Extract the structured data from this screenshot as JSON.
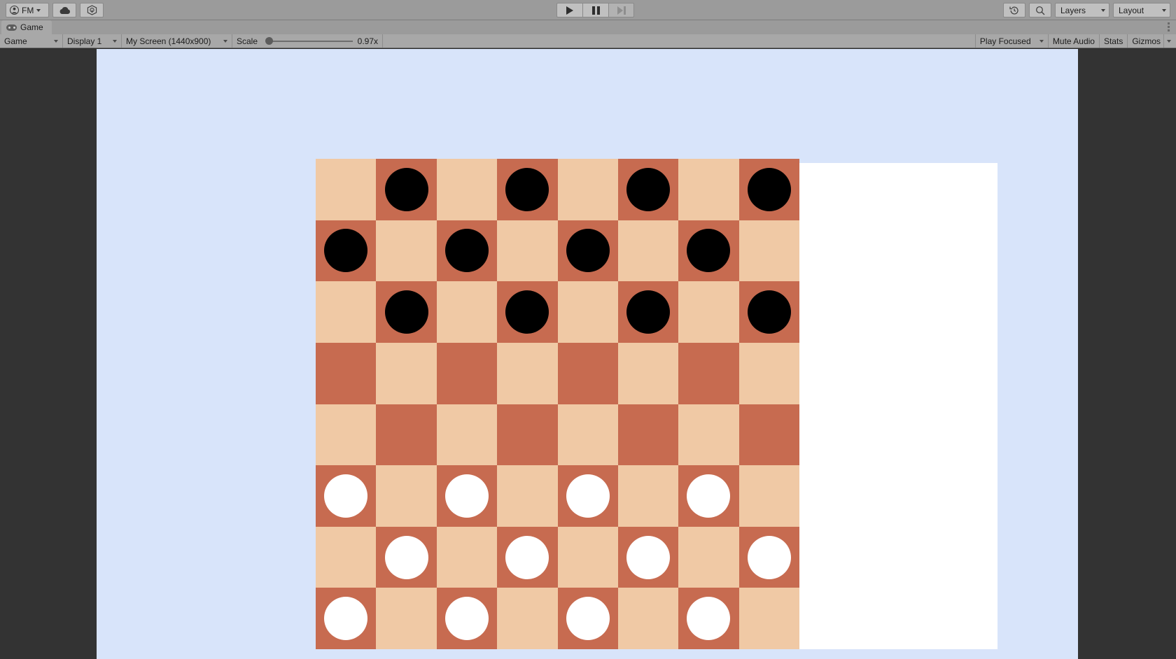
{
  "top_toolbar": {
    "account": {
      "label": "FM",
      "icon": "account-icon"
    },
    "cloud": {
      "icon": "cloud-icon"
    },
    "package_manager": {
      "icon": "package-manager-icon"
    },
    "play_controls": {
      "play": {
        "label": "",
        "icon": "play-icon",
        "state": "off"
      },
      "pause": {
        "label": "",
        "icon": "pause-icon",
        "state": "off"
      },
      "step": {
        "label": "",
        "icon": "step-icon",
        "state": "disabled"
      }
    },
    "undo_history": {
      "icon": "undo-history-icon"
    },
    "search": {
      "icon": "search-icon"
    },
    "layers": {
      "label": "Layers",
      "icon": "chevron-down-icon"
    },
    "layout": {
      "label": "Layout",
      "icon": "chevron-down-icon"
    }
  },
  "tabstrip": {
    "tabs": [
      {
        "label": "Game",
        "icon": "gamepad-icon",
        "active": true
      }
    ],
    "overflow_menu": {
      "icon": "kebab-menu-icon"
    }
  },
  "game_toolbar": {
    "view_mode": {
      "label": "Game",
      "icon": "chevron-down-icon"
    },
    "display": {
      "label": "Display 1",
      "icon": "chevron-down-icon"
    },
    "resolution": {
      "label": "My Screen (1440x900)",
      "icon": "chevron-down-icon"
    },
    "scale": {
      "label": "Scale",
      "value": "0.97x",
      "slider_pct": 3
    },
    "play_mode": {
      "label": "Play Focused",
      "icon": "chevron-down-icon"
    },
    "mute_audio": {
      "label": "Mute Audio"
    },
    "stats": {
      "label": "Stats"
    },
    "gizmos": {
      "label": "Gizmos",
      "icon": "chevron-down-icon"
    }
  },
  "game_view": {
    "background_color": "#d8e4fa",
    "editor_background_color": "#333333",
    "side_panel": {
      "color": "#ffffff",
      "name": "ui-canvas-panel"
    },
    "board": {
      "rows": 8,
      "cols": 8,
      "light_square_color": "#f0c9a5",
      "dark_square_color": "#c76b50",
      "black_piece_color": "#000000",
      "white_piece_color": "#ffffff",
      "layout": [
        [
          "",
          "b",
          "",
          "b",
          "",
          "b",
          "",
          "b"
        ],
        [
          "b",
          "",
          "b",
          "",
          "b",
          "",
          "b",
          ""
        ],
        [
          "",
          "b",
          "",
          "b",
          "",
          "b",
          "",
          "b"
        ],
        [
          "",
          "",
          "",
          "",
          "",
          "",
          "",
          ""
        ],
        [
          "",
          "",
          "",
          "",
          "",
          "",
          "",
          ""
        ],
        [
          "w",
          "",
          "w",
          "",
          "w",
          "",
          "w",
          ""
        ],
        [
          "",
          "w",
          "",
          "w",
          "",
          "w",
          "",
          "w"
        ],
        [
          "w",
          "",
          "w",
          "",
          "w",
          "",
          "w",
          ""
        ]
      ],
      "square_colors": [
        [
          "light",
          "dark",
          "light",
          "dark",
          "light",
          "dark",
          "light",
          "dark"
        ],
        [
          "dark",
          "light",
          "dark",
          "light",
          "dark",
          "light",
          "dark",
          "light"
        ],
        [
          "light",
          "dark",
          "light",
          "dark",
          "light",
          "dark",
          "light",
          "dark"
        ],
        [
          "dark",
          "light",
          "dark",
          "light",
          "dark",
          "light",
          "dark",
          "light"
        ],
        [
          "light",
          "dark",
          "light",
          "dark",
          "light",
          "dark",
          "light",
          "dark"
        ],
        [
          "dark",
          "light",
          "dark",
          "light",
          "dark",
          "light",
          "dark",
          "light"
        ],
        [
          "light",
          "dark",
          "light",
          "dark",
          "light",
          "dark",
          "light",
          "dark"
        ],
        [
          "dark",
          "light",
          "dark",
          "light",
          "dark",
          "light",
          "dark",
          "light"
        ]
      ]
    }
  }
}
